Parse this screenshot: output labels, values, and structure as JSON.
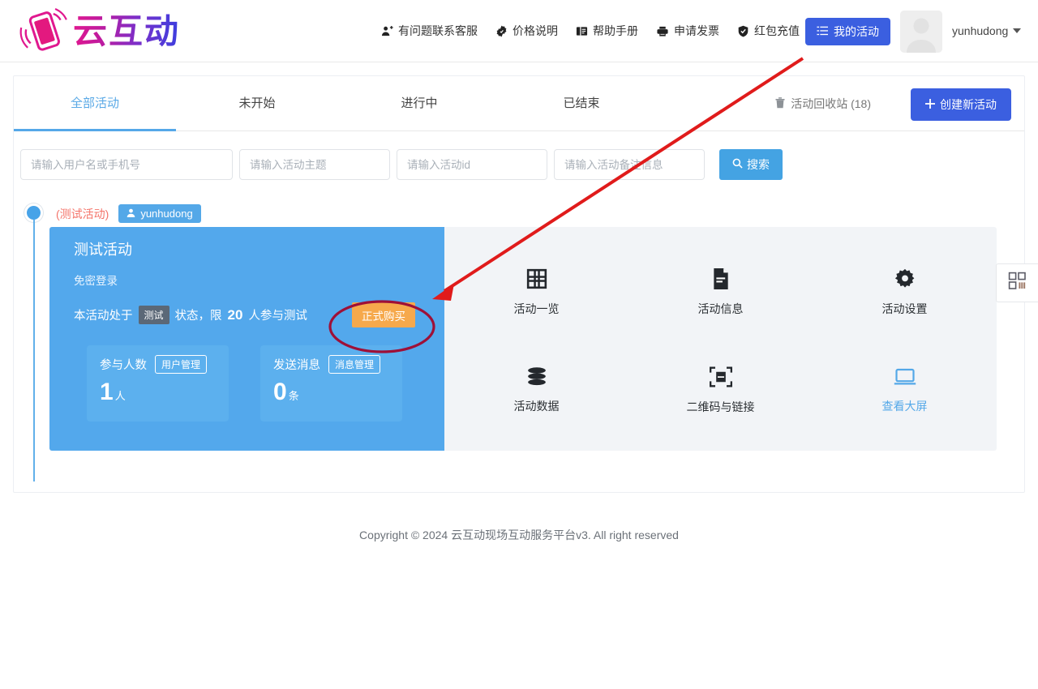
{
  "header": {
    "logo_text": "云互动",
    "logo_icon": "phone-motion-icon",
    "nav": [
      {
        "label": "有问题联系客服",
        "icon": "user-headset-icon"
      },
      {
        "label": "价格说明",
        "icon": "price-badge-icon"
      },
      {
        "label": "帮助手册",
        "icon": "book-icon"
      },
      {
        "label": "申请发票",
        "icon": "printer-icon"
      },
      {
        "label": "红包充值",
        "icon": "shield-check-icon"
      }
    ],
    "my_activity_button": "我的活动",
    "my_activity_icon": "list-icon",
    "avatar_icon": "user-avatar-placeholder",
    "user_name": "yunhudong",
    "user_caret_icon": "caret-down-icon"
  },
  "tabs": [
    {
      "label": "全部活动",
      "active": true
    },
    {
      "label": "未开始",
      "active": false
    },
    {
      "label": "进行中",
      "active": false
    },
    {
      "label": "已结束",
      "active": false
    }
  ],
  "toolbar": {
    "recycle_label": "活动回收站 (18)",
    "recycle_icon": "trash-icon",
    "create_label": "创建新活动",
    "create_icon": "plus-icon"
  },
  "search": {
    "placeholder_user": "请输入用户名或手机号",
    "placeholder_topic": "请输入活动主题",
    "placeholder_id": "请输入活动id",
    "placeholder_remark": "请输入活动备注信息",
    "value_user": "",
    "value_topic": "",
    "value_id": "",
    "value_remark": "",
    "button_label": "搜索",
    "button_icon": "search-icon"
  },
  "activity": {
    "test_tag": "(测试活动)",
    "owner_badge": "yunhudong",
    "owner_icon": "user-icon",
    "title": "测试活动",
    "subtitle": "免密登录",
    "status_prefix": "本活动处于",
    "status_chip": "测试",
    "status_middle": "状态，限",
    "status_limit": "20",
    "status_suffix": "人参与测试",
    "buy_button": "正式购买",
    "stats": [
      {
        "label": "参与人数",
        "action": "用户管理",
        "value": "1",
        "unit": "人"
      },
      {
        "label": "发送消息",
        "action": "消息管理",
        "value": "0",
        "unit": "条"
      }
    ],
    "actions": [
      {
        "label": "活动一览",
        "icon": "grid-icon",
        "highlight": false
      },
      {
        "label": "活动信息",
        "icon": "document-icon",
        "highlight": false
      },
      {
        "label": "活动设置",
        "icon": "gear-icon",
        "highlight": false
      },
      {
        "label": "活动数据",
        "icon": "database-icon",
        "highlight": false
      },
      {
        "label": "二维码与链接",
        "icon": "qr-scan-icon",
        "highlight": false
      },
      {
        "label": "查看大屏",
        "icon": "laptop-icon",
        "highlight": true
      }
    ]
  },
  "side_tab": {
    "icon": "apps-grid-icon"
  },
  "footer": {
    "copyright": "Copyright © 2024 云互动现场互动服务平台v3. All right reserved"
  },
  "annotation": {
    "arrow_color": "#e01b1b",
    "circle_color": "#9e1038",
    "arrow_from": "990,72",
    "arrow_to": "533,369"
  },
  "colors": {
    "primary_blue": "#3b5fe0",
    "light_blue": "#53a8ec",
    "orange": "#f6a94c",
    "panel_grey": "#f2f4f7",
    "red_tag": "#f4746a"
  }
}
